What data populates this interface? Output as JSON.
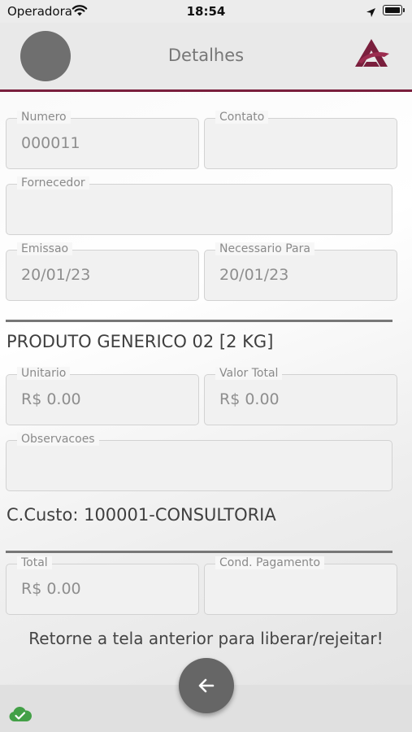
{
  "status_bar": {
    "carrier": "Operadora",
    "time": "18:54"
  },
  "header": {
    "title": "Detalhes",
    "accent_color": "#7a1f3d"
  },
  "fields": {
    "numero": {
      "label": "Numero",
      "value": "000011"
    },
    "contato": {
      "label": "Contato",
      "value": ""
    },
    "fornecedor": {
      "label": "Fornecedor",
      "value": ""
    },
    "emissao": {
      "label": "Emissao",
      "value": "20/01/23"
    },
    "necessario_para": {
      "label": "Necessario Para",
      "value": "20/01/23"
    },
    "unitario": {
      "label": "Unitario",
      "value": "R$ 0.00"
    },
    "valor_total": {
      "label": "Valor Total",
      "value": "R$ 0.00"
    },
    "observacoes": {
      "label": "Observacoes",
      "value": ""
    },
    "total": {
      "label": "Total",
      "value": "R$ 0.00"
    },
    "cond_pagamento": {
      "label": "Cond. Pagamento",
      "value": ""
    }
  },
  "product": {
    "name": "PRODUTO GENERICO 02 [2 KG]"
  },
  "cost_center": {
    "text": "C.Custo: 100001-CONSULTORIA"
  },
  "notice": {
    "text": "Retorne a tela anterior para liberar/rejeitar!"
  },
  "icons": {
    "back": "arrow-left-icon",
    "sync": "cloud-check-icon",
    "sync_color": "#43a047"
  }
}
